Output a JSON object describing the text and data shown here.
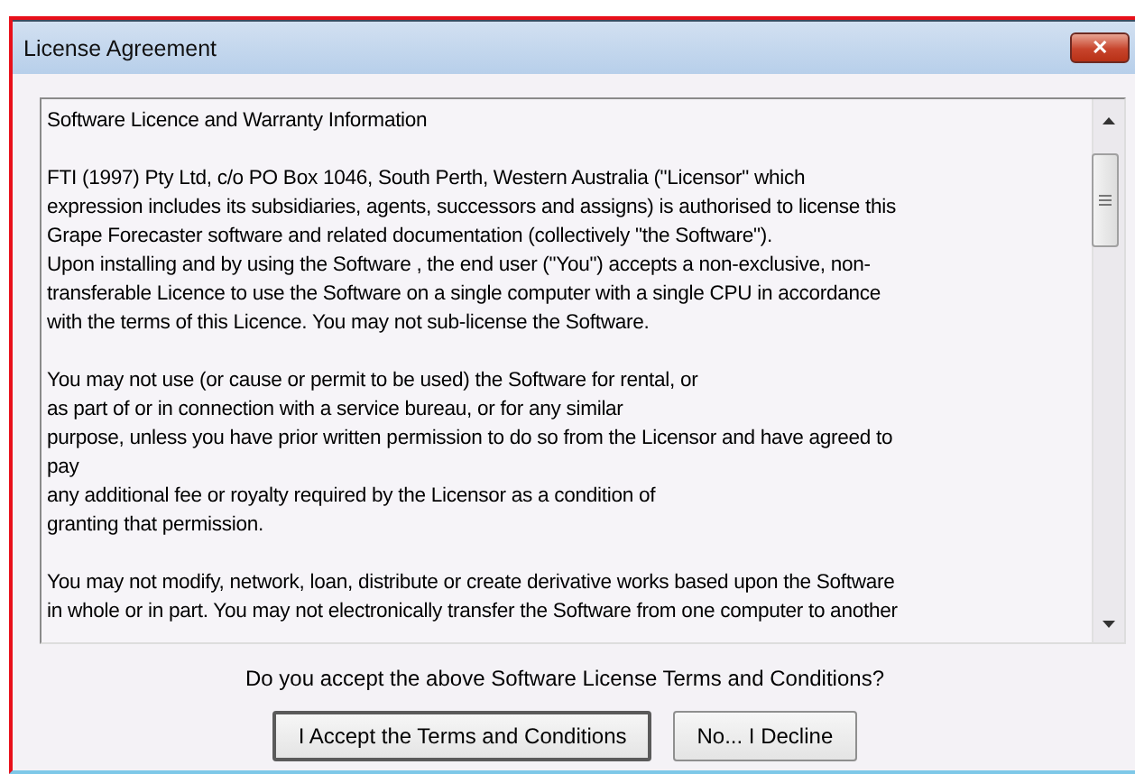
{
  "window": {
    "title": "License Agreement",
    "close": "✕"
  },
  "license_text": {
    "paragraphs": [
      {
        "lines": [
          "Software Licence and Warranty Information"
        ]
      },
      {
        "lines": [
          "FTI (1997) Pty Ltd, c/o PO Box 1046, South Perth, Western Australia (\"Licensor\" which",
          "expression includes its subsidiaries, agents, successors and assigns) is authorised to license this",
          "Grape Forecaster software and related documentation (collectively \"the Software\").",
          "Upon installing and by using the Software , the end user (\"You\") accepts a non-exclusive, non-",
          "transferable Licence to use the Software on a single computer with a single CPU in accordance",
          "with the terms of this Licence.  You may not sub-license the Software."
        ]
      },
      {
        "lines": [
          "You may not use (or cause or permit to be used) the Software for rental, or",
          "as part of or in connection with a service bureau, or for any similar",
          "purpose, unless you have prior written permission to do so from the Licensor and have agreed to",
          "pay",
          "any additional fee or royalty required by the Licensor as a condition of",
          "granting that permission."
        ]
      },
      {
        "lines": [
          "You may not modify, network, loan, distribute or create derivative works based upon the Software",
          "in whole or in part.  You may not electronically transfer the Software from one computer to another"
        ]
      }
    ]
  },
  "question": "Do you accept the above Software License Terms and Conditions?",
  "buttons": [
    {
      "label": "I Accept the Terms and Conditions",
      "focused": true
    },
    {
      "label": "No... I Decline",
      "focused": false
    }
  ]
}
